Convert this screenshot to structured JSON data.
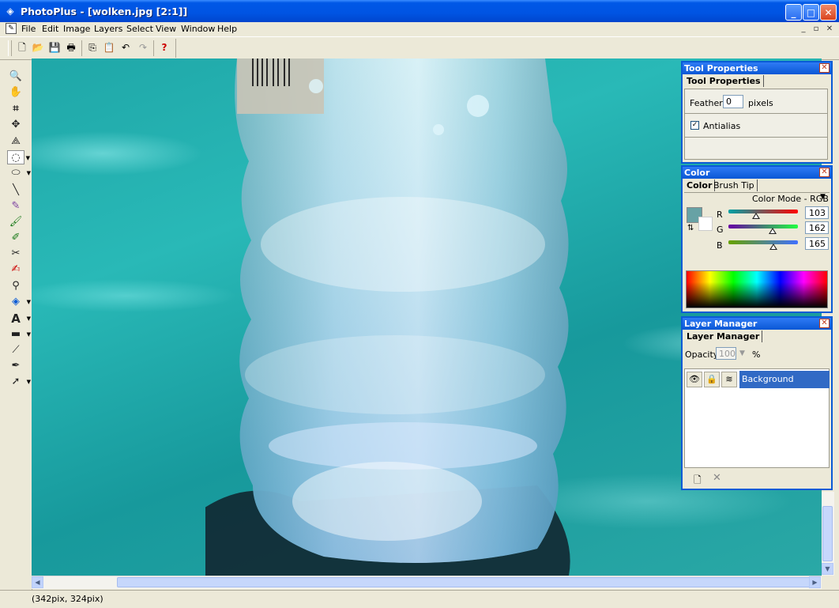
{
  "window": {
    "app_name": "PhotoPlus",
    "title": "PhotoPlus - [wolken.jpg [2:1]]",
    "minimize": "_",
    "maximize": "□",
    "close": "✕"
  },
  "menu": {
    "items": [
      "File",
      "Edit",
      "Image",
      "Layers",
      "Select",
      "View",
      "Window",
      "Help"
    ],
    "mdi_min": "_",
    "mdi_restore": "▫",
    "mdi_close": "✕"
  },
  "toolbar": {
    "buttons": [
      "new-icon",
      "open-icon",
      "save-icon",
      "print-icon",
      "copy-icon",
      "paste-icon",
      "undo-icon",
      "redo-icon",
      "help-icon"
    ]
  },
  "tools": [
    "zoom-tool",
    "hand-tool",
    "crop-tool",
    "move-tool",
    "perspective-tool",
    "lasso-tool",
    "ellipse-select-tool",
    "line-tool",
    "pencil-tool",
    "paintbrush-tool",
    "clone-tool",
    "eraser-tool",
    "smudge-tool",
    "color-picker-tool",
    "fill-tool",
    "text-tool",
    "shape-tool",
    "straight-line-tool",
    "pen-tool",
    "node-select-tool"
  ],
  "tool_properties": {
    "header": "Tool Properties",
    "tab": "Tool Properties",
    "feather_label": "Feather:",
    "feather_value": "0",
    "feather_unit": "pixels",
    "antialias_label": "Antialias",
    "antialias_checked": true
  },
  "color_panel": {
    "header": "Color",
    "tabs": [
      "Color",
      "Brush Tip"
    ],
    "mode_label": "Color Mode - RGB",
    "r_label": "R",
    "g_label": "G",
    "b_label": "B",
    "r_value": "103",
    "g_value": "162",
    "b_value": "165",
    "r_level": 0.4,
    "g_level": 0.64,
    "b_level": 0.65,
    "swatch_color": "#67a2a5"
  },
  "layer_manager": {
    "header": "Layer Manager",
    "tab": "Layer Manager",
    "opacity_label": "Opacity:",
    "opacity_value": "100",
    "opacity_unit": "%",
    "layers": [
      {
        "name": "Background",
        "selected": true
      }
    ]
  },
  "status": {
    "coords": "(342pix, 324pix)"
  },
  "colors": {
    "title_blue": "#0054e3",
    "selection_blue": "#316ac5",
    "pool_teal": "#1fa7a8"
  }
}
